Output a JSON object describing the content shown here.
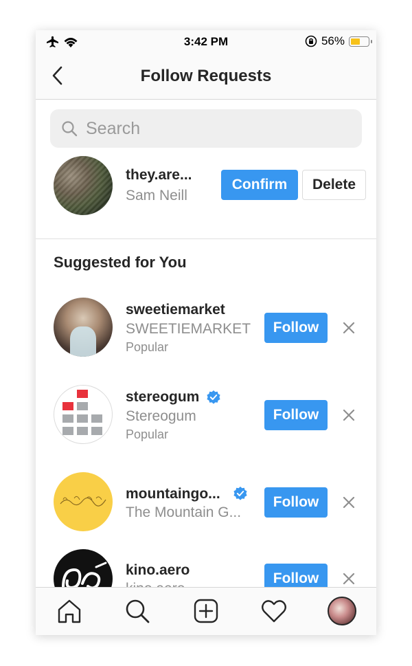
{
  "status_bar": {
    "time": "3:42 PM",
    "battery_percent": "56%",
    "battery_level": 0.56
  },
  "header": {
    "title": "Follow Requests"
  },
  "search": {
    "placeholder": "Search"
  },
  "follow_request": {
    "username": "they.are...",
    "full_name": "Sam Neill",
    "confirm_label": "Confirm",
    "delete_label": "Delete"
  },
  "suggested": {
    "title": "Suggested for You",
    "follow_label": "Follow",
    "items": [
      {
        "username": "sweetiemarket",
        "full_name": "SWEETIEMARKET",
        "reason": "Popular",
        "verified": false
      },
      {
        "username": "stereogum",
        "full_name": "Stereogum",
        "reason": "Popular",
        "verified": true
      },
      {
        "username": "mountaingo...",
        "full_name": "The Mountain G...",
        "reason": "",
        "verified": true
      },
      {
        "username": "kino.aero",
        "full_name": "kino.aero",
        "reason": "",
        "verified": false
      }
    ]
  },
  "tab_bar": {
    "icons": [
      "home-icon",
      "search-icon",
      "add-post-icon",
      "activity-heart-icon",
      "profile-avatar"
    ]
  },
  "colors": {
    "accent": "#3897f0",
    "secondary_text": "#8e8e8e",
    "primary_text": "#262626",
    "battery": "#f7c21a"
  }
}
